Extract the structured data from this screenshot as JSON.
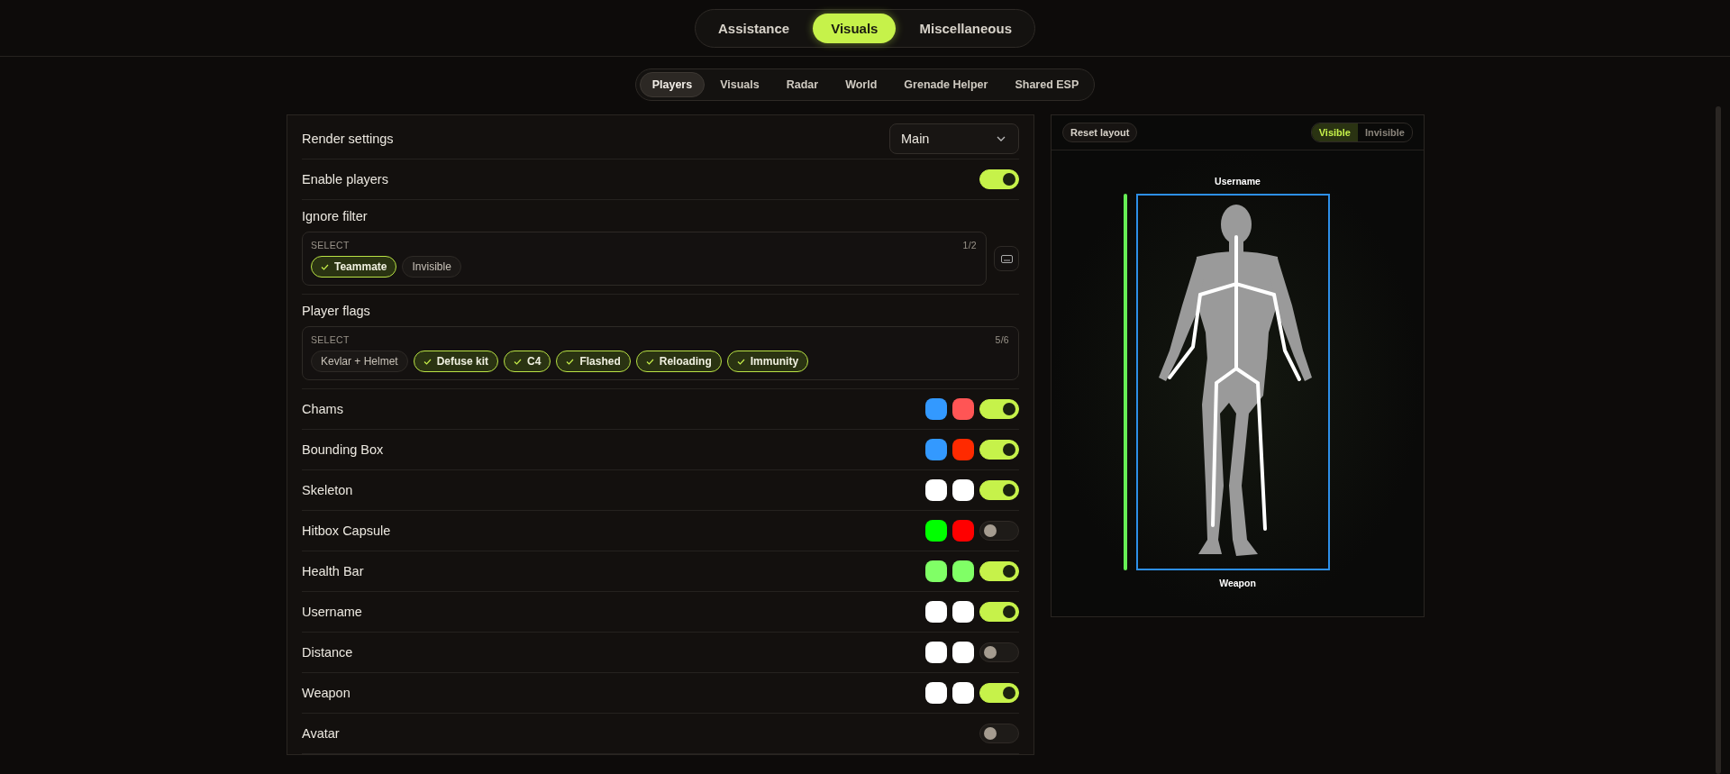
{
  "main_tabs": [
    {
      "label": "Assistance",
      "selected": false
    },
    {
      "label": "Visuals",
      "selected": true
    },
    {
      "label": "Miscellaneous",
      "selected": false
    }
  ],
  "sub_tabs": [
    {
      "label": "Players",
      "selected": true
    },
    {
      "label": "Visuals",
      "selected": false
    },
    {
      "label": "Radar",
      "selected": false
    },
    {
      "label": "World",
      "selected": false
    },
    {
      "label": "Grenade Helper",
      "selected": false
    },
    {
      "label": "Shared ESP",
      "selected": false
    }
  ],
  "render_settings": {
    "label": "Render settings",
    "value": "Main"
  },
  "enable_players": {
    "label": "Enable players",
    "on": true
  },
  "ignore_filter": {
    "label": "Ignore filter",
    "select_label": "SELECT",
    "count": "1/2",
    "options": [
      {
        "label": "Teammate",
        "selected": true
      },
      {
        "label": "Invisible",
        "selected": false
      }
    ]
  },
  "player_flags": {
    "label": "Player flags",
    "select_label": "SELECT",
    "count": "5/6",
    "options": [
      {
        "label": "Kevlar + Helmet",
        "selected": false
      },
      {
        "label": "Defuse kit",
        "selected": true
      },
      {
        "label": "C4",
        "selected": true
      },
      {
        "label": "Flashed",
        "selected": true
      },
      {
        "label": "Reloading",
        "selected": true
      },
      {
        "label": "Immunity",
        "selected": true
      }
    ]
  },
  "features": [
    {
      "label": "Chams",
      "on": true,
      "swatches": [
        {
          "color": "#3399ff"
        },
        {
          "color": "#ff5555"
        }
      ]
    },
    {
      "label": "Bounding Box",
      "on": true,
      "swatches": [
        {
          "color": "#3399ff"
        },
        {
          "color": "#ff2a00"
        }
      ]
    },
    {
      "label": "Skeleton",
      "on": true,
      "swatches": [
        {
          "color": "#ffffff"
        },
        {
          "color": "#ffffff"
        }
      ]
    },
    {
      "label": "Hitbox Capsule",
      "on": false,
      "swatches": [
        {
          "color": "#00ff00"
        },
        {
          "color": "#ff0000"
        }
      ]
    },
    {
      "label": "Health Bar",
      "on": true,
      "swatches": [
        {
          "color": "#80ff66"
        },
        {
          "color": "#80ff66"
        }
      ]
    },
    {
      "label": "Username",
      "on": true,
      "swatches": [
        {
          "color": "#ffffff"
        },
        {
          "color": "#ffffff"
        }
      ]
    },
    {
      "label": "Distance",
      "on": false,
      "swatches": [
        {
          "color": "#ffffff"
        },
        {
          "color": "#ffffff"
        }
      ]
    },
    {
      "label": "Weapon",
      "on": true,
      "swatches": [
        {
          "color": "#ffffff"
        },
        {
          "color": "#ffffff"
        }
      ]
    },
    {
      "label": "Avatar",
      "on": false
    }
  ],
  "preview": {
    "reset_label": "Reset layout",
    "modes": [
      {
        "label": "Visible",
        "selected": true
      },
      {
        "label": "Invisible",
        "selected": false
      }
    ],
    "top_label": "Username",
    "bottom_label": "Weapon"
  }
}
